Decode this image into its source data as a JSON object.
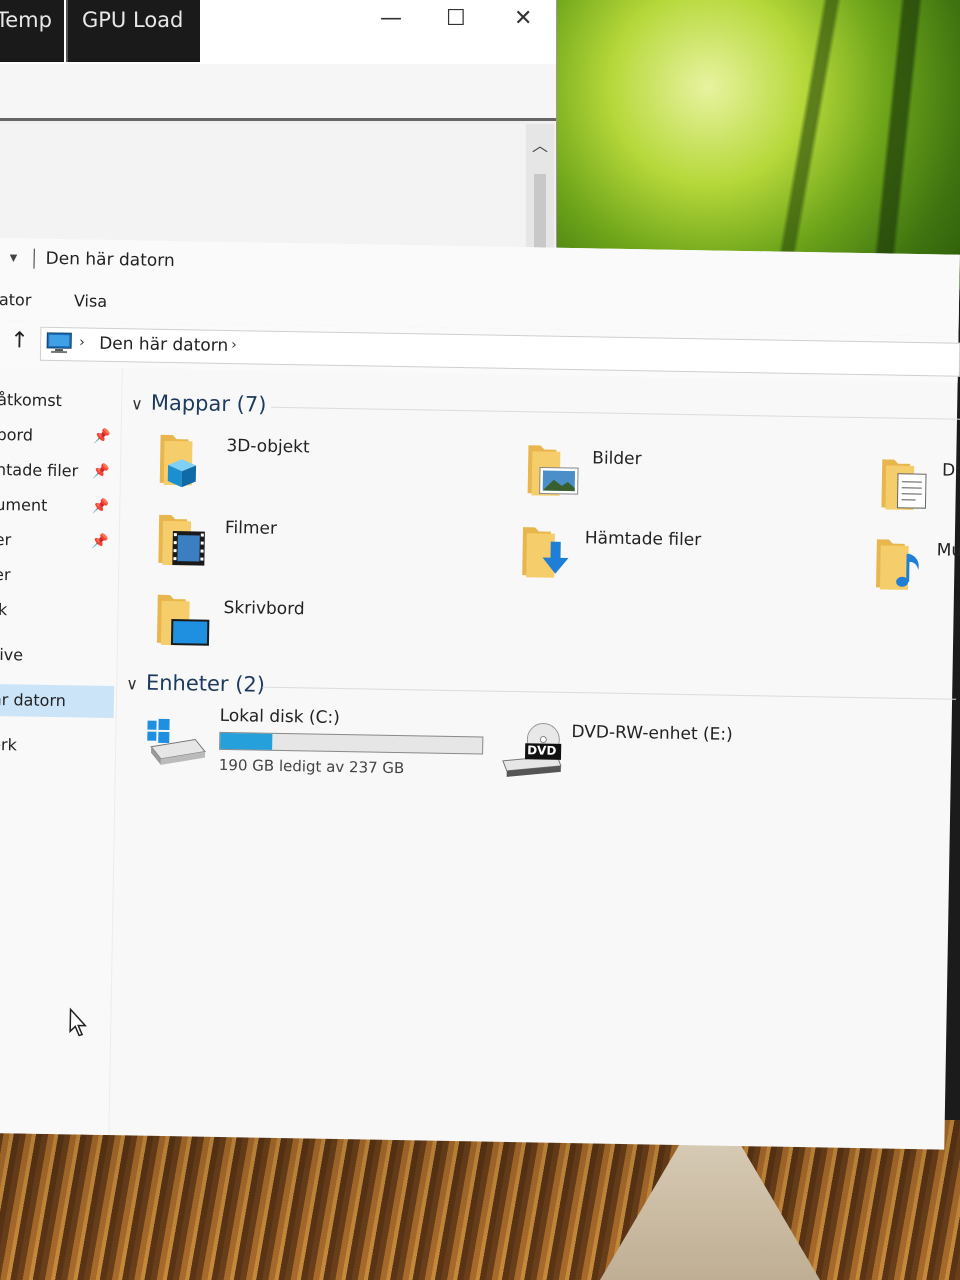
{
  "background_window": {
    "tabs": [
      "Temp",
      "GPU Load"
    ],
    "controls": {
      "minimize": "—",
      "maximize": "☐",
      "close": "✕"
    }
  },
  "explorer": {
    "window_title": "Den här datorn",
    "quick_access_arrow": "▾",
    "menu": [
      "ator",
      "Visa"
    ],
    "address": {
      "crumb": "Den här datorn",
      "chevron": "›"
    },
    "nav_items": [
      {
        "label": "åtkomst",
        "pinned": false,
        "selected": false
      },
      {
        "label": "bord",
        "pinned": true,
        "selected": false
      },
      {
        "label": "ntade filer",
        "pinned": true,
        "selected": false
      },
      {
        "label": "ument",
        "pinned": true,
        "selected": false
      },
      {
        "label": "er",
        "pinned": true,
        "selected": false
      },
      {
        "label": "er",
        "pinned": false,
        "selected": false
      },
      {
        "label": "ik",
        "pinned": false,
        "selected": false
      },
      {
        "label": "rive",
        "pinned": false,
        "selected": false
      },
      {
        "label": "är datorn",
        "pinned": false,
        "selected": true
      },
      {
        "label": "erk",
        "pinned": false,
        "selected": false
      }
    ],
    "pin_glyph": "📌",
    "groups": {
      "folders": {
        "heading": "Mappar (7)",
        "items": [
          {
            "label": "3D-objekt",
            "icon": "3d-objects-folder-icon"
          },
          {
            "label": "Bilder",
            "icon": "pictures-folder-icon"
          },
          {
            "label": "Do",
            "icon": "documents-folder-icon"
          },
          {
            "label": "Filmer",
            "icon": "videos-folder-icon"
          },
          {
            "label": "Hämtade filer",
            "icon": "downloads-folder-icon"
          },
          {
            "label": "Mu",
            "icon": "music-folder-icon"
          },
          {
            "label": "Skrivbord",
            "icon": "desktop-folder-icon"
          }
        ]
      },
      "devices": {
        "heading": "Enheter (2)",
        "items": [
          {
            "label": "Lokal disk (C:)",
            "free_text": "190 GB ledigt av 237 GB",
            "used_fraction": 0.2,
            "icon": "windows-drive-icon"
          },
          {
            "label": "DVD-RW-enhet (E:)",
            "icon": "dvd-drive-icon",
            "badge": "DVD"
          }
        ]
      }
    }
  },
  "colors": {
    "accent": "#26a0da",
    "selection": "#cce4f7",
    "folder": "#f2c45c"
  }
}
